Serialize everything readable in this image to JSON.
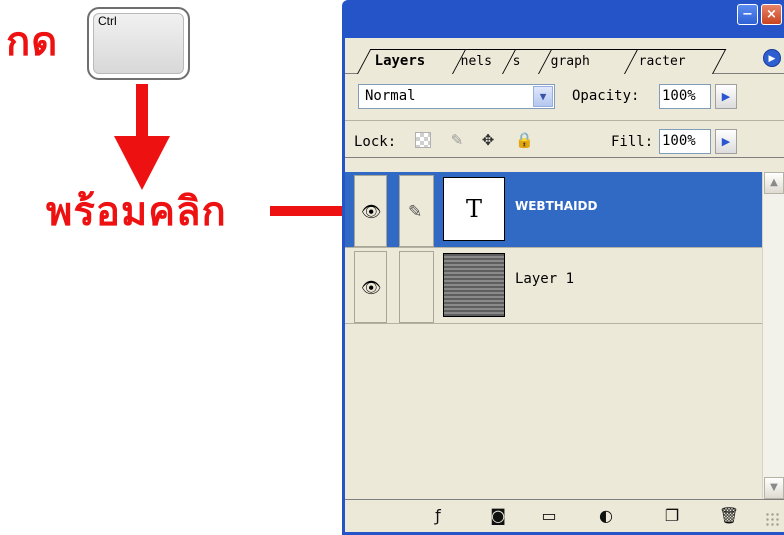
{
  "annotation": {
    "press_text": "กด",
    "key_label": "Ctrl",
    "click_text": "พร้อมคลิก",
    "arrow_color": "#ee1111"
  },
  "palette": {
    "tabs": [
      {
        "label": "Layers",
        "active": true
      },
      {
        "label": "Channels",
        "visible_text": "nels"
      },
      {
        "label": "Paths",
        "visible_text": "s"
      },
      {
        "label": "Paragraph",
        "visible_text": "graph"
      },
      {
        "label": "Character",
        "visible_text": "racter"
      }
    ],
    "blend_mode": "Normal",
    "opacity_label": "Opacity:",
    "opacity_value": "100%",
    "lock_label": "Lock:",
    "fill_label": "Fill:",
    "fill_value": "100%",
    "layers": [
      {
        "name": "WEBTHAIDD",
        "thumb": "T",
        "selected": true
      },
      {
        "name": "Layer 1",
        "selected": false
      }
    ],
    "colors": {
      "frame": "#2553c8",
      "panel": "#ece9d8",
      "selection": "#316ac5"
    }
  }
}
